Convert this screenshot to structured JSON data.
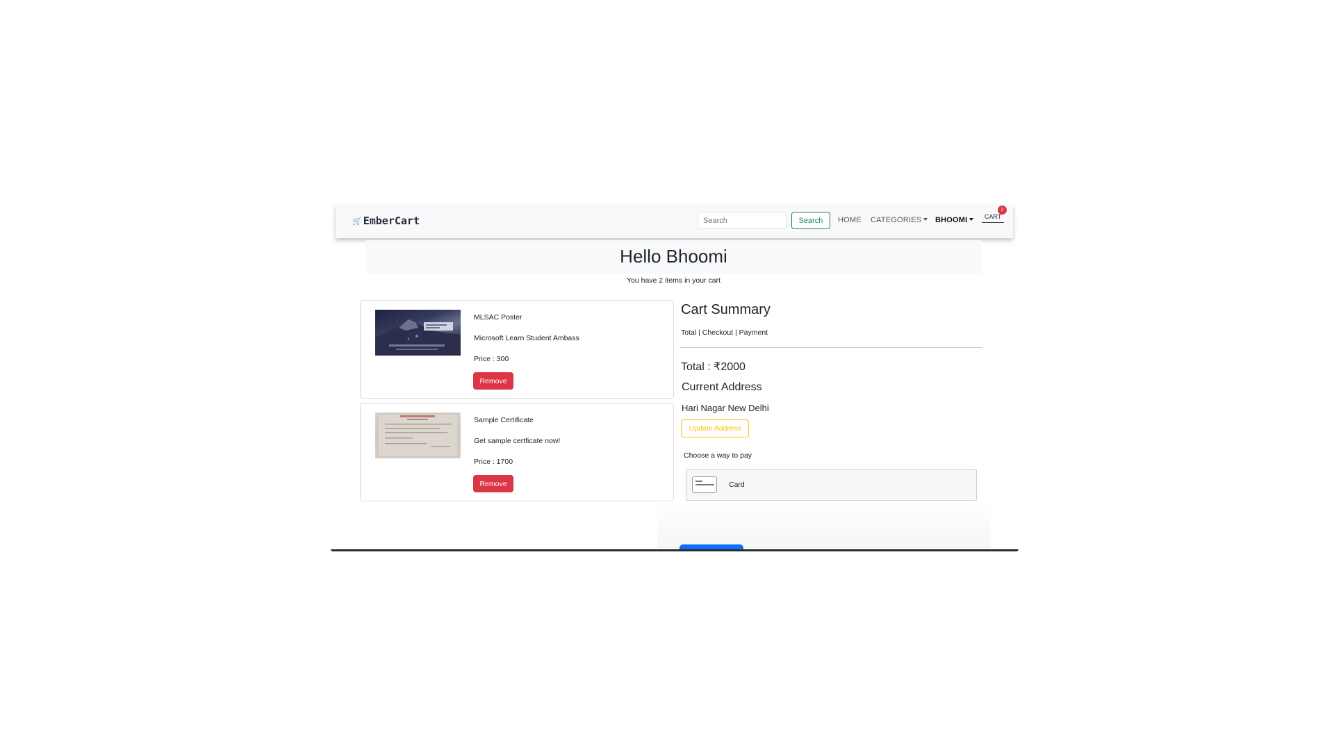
{
  "navbar": {
    "brand": "EmberCart",
    "search_placeholder": "Search",
    "search_button": "Search",
    "home": "HOME",
    "categories": "CATEGORIES",
    "user": "BHOOMI",
    "cart": "CART",
    "cart_count": "2"
  },
  "hero": {
    "title": "Hello Bhoomi",
    "subtitle": "You have 2 items in your cart"
  },
  "items": [
    {
      "name": "MLSAC Poster",
      "description": "Microsoft Learn Student Ambass",
      "price": "Price : 300",
      "remove_label": "Remove"
    },
    {
      "name": "Sample Certificate",
      "description": "Get sample certficate now!",
      "price": "Price : 1700",
      "remove_label": "Remove"
    }
  ],
  "summary": {
    "title": "Cart Summary",
    "links": "Total | Checkout | Payment",
    "total": "Total : ₹2000",
    "address_title": "Current Address",
    "address": "Hari Nagar New Delhi",
    "update_address": "Update Address",
    "pay_label": "Choose a way to pay",
    "pay_option": "Card"
  },
  "colors": {
    "danger": "#dc3545",
    "success": "#198754",
    "warning": "#ffc107",
    "primary": "#0d6efd",
    "light_bg": "#f8f9fa"
  },
  "icons": {
    "brand": "shopping-cart-icon",
    "payment": "credit-card-icon"
  }
}
